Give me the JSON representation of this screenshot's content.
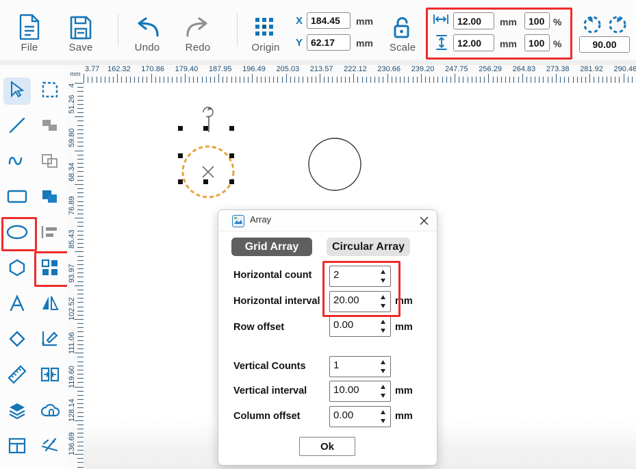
{
  "toolbar": {
    "buttons": [
      {
        "name": "file",
        "label": "File",
        "icon": "document-icon"
      },
      {
        "name": "save",
        "label": "Save",
        "icon": "floppy-disk-icon"
      },
      {
        "name": "undo",
        "label": "Undo",
        "icon": "undo-arrow-icon"
      },
      {
        "name": "redo",
        "label": "Redo",
        "icon": "redo-arrow-icon"
      },
      {
        "name": "origin",
        "label": "Origin",
        "icon": "origin-grid-icon"
      },
      {
        "name": "scale",
        "label": "Scale",
        "icon": "unlock-icon"
      }
    ],
    "position": {
      "x_label": "X",
      "x_value": "184.45",
      "x_unit": "mm",
      "y_label": "Y",
      "y_value": "62.17",
      "y_unit": "mm"
    },
    "size": {
      "width_value": "12.00",
      "width_unit": "mm",
      "width_percent": "100",
      "width_percent_unit": "%",
      "height_value": "12.00",
      "height_unit": "mm",
      "height_percent": "100",
      "height_percent_unit": "%"
    },
    "rotate": {
      "ccw_icon": "rotate-counterclockwise-icon",
      "cw_icon": "rotate-clockwise-icon",
      "angle": "90.00"
    }
  },
  "palette": {
    "items": [
      {
        "name": "select-tool",
        "icon": "cursor-arrow-icon",
        "selected": true
      },
      {
        "name": "node-edit-tool",
        "icon": "dashed-corner-icon",
        "selected": false
      },
      {
        "name": "line-tool",
        "icon": "line-icon",
        "selected": false
      },
      {
        "name": "union-tool",
        "icon": "union-shapes-icon",
        "selected": false
      },
      {
        "name": "curve-tool",
        "icon": "wave-curve-icon",
        "selected": false
      },
      {
        "name": "intersect-tool",
        "icon": "intersect-shapes-icon",
        "selected": false
      },
      {
        "name": "rectangle-tool",
        "icon": "rectangle-icon",
        "selected": false
      },
      {
        "name": "subtract-tool",
        "icon": "subtract-shapes-icon",
        "selected": false
      },
      {
        "name": "ellipse-tool",
        "icon": "ellipse-icon",
        "selected": false,
        "highlighted": true
      },
      {
        "name": "align-tool",
        "icon": "align-left-icon",
        "selected": false
      },
      {
        "name": "polygon-tool",
        "icon": "hexagon-icon",
        "selected": false
      },
      {
        "name": "array-tool",
        "icon": "array-grid-icon",
        "selected": false,
        "highlighted": true
      },
      {
        "name": "text-tool",
        "icon": "text-a-icon",
        "selected": false
      },
      {
        "name": "mirror-tool",
        "icon": "mirror-icon",
        "selected": false
      },
      {
        "name": "eraser-tool",
        "icon": "eraser-icon",
        "selected": false
      },
      {
        "name": "measure-angle-tool",
        "icon": "angle-measure-icon",
        "selected": false
      },
      {
        "name": "ruler-tool",
        "icon": "ruler-icon",
        "selected": false
      },
      {
        "name": "fit-width-tool",
        "icon": "fit-width-icon",
        "selected": false
      },
      {
        "name": "layers-tool",
        "icon": "layers-stack-icon",
        "selected": false
      },
      {
        "name": "cloud-tool",
        "icon": "cloud-icon",
        "selected": false
      },
      {
        "name": "layout-tool",
        "icon": "layout-panel-icon",
        "selected": false
      },
      {
        "name": "axis-tool",
        "icon": "axis-3d-icon",
        "selected": false
      }
    ]
  },
  "rulers": {
    "unit_label": "mm",
    "horizontal": [
      "3.77",
      "162.32",
      "170.86",
      "179.40",
      "187.95",
      "196.49",
      "205.03",
      "213.57",
      "222.12",
      "230.66",
      "239.20",
      "247.75",
      "256.29",
      "264.83",
      "273.38",
      "281.92",
      "290.46"
    ],
    "vertical": [
      "4",
      "51.26",
      "59.80",
      "68.34",
      "76.89",
      "85.43",
      "93.97",
      "102.52",
      "111.06",
      "119.60",
      "128.14",
      "136.69"
    ]
  },
  "canvas": {
    "selected_shape": {
      "name": "selected-circle",
      "center_marker": "x-cross-icon",
      "rotate_handle": "rotate-handle-icon",
      "stroke": "#E8A33D"
    },
    "other_shape": {
      "name": "circle-shape",
      "stroke": "#333333"
    }
  },
  "dialog": {
    "title": "Array",
    "title_icon": "array-app-icon",
    "close_icon": "close-icon",
    "tabs": [
      {
        "name": "grid-array",
        "label": "Grid Array",
        "active": true
      },
      {
        "name": "circular-array",
        "label": "Circular Array",
        "active": false
      }
    ],
    "fields": [
      {
        "name": "horizontal-count",
        "label": "Horizontal count",
        "value": "2",
        "unit": "",
        "highlighted": true
      },
      {
        "name": "horizontal-interval",
        "label": "Horizontal interval",
        "value": "20.00",
        "unit": "mm",
        "highlighted": true
      },
      {
        "name": "row-offset",
        "label": "Row offset",
        "value": "0.00",
        "unit": "mm",
        "highlighted": false
      },
      {
        "name": "vertical-counts",
        "label": "Vertical Counts",
        "value": "1",
        "unit": "",
        "highlighted": false
      },
      {
        "name": "vertical-interval",
        "label": "Vertical interval",
        "value": "10.00",
        "unit": "mm",
        "highlighted": false
      },
      {
        "name": "column-offset",
        "label": "Column offset",
        "value": "0.00",
        "unit": "mm",
        "highlighted": false
      }
    ],
    "ok_label": "Ok"
  },
  "colors": {
    "accent": "#1576b8",
    "annotation": "#ee2b2b",
    "selection": "#E8A33D",
    "toolbar_text": "#54575b"
  }
}
